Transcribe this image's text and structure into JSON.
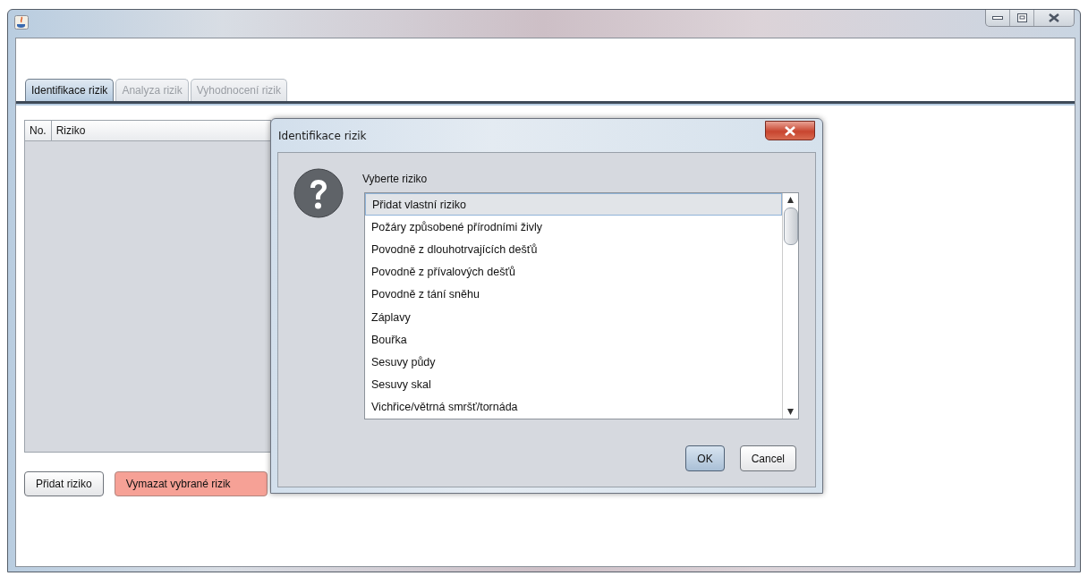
{
  "tabs": [
    {
      "label": "Identifikace rizik",
      "selected": true,
      "disabled": false
    },
    {
      "label": "Analyza rizik",
      "selected": false,
      "disabled": true
    },
    {
      "label": "Vyhodnocení rizik",
      "selected": false,
      "disabled": true
    }
  ],
  "table": {
    "columns": [
      "No.",
      "Riziko"
    ]
  },
  "buttons": [
    {
      "label": "Přidat riziko",
      "kind": "normal"
    },
    {
      "label": "Vymazat vybrané rizik",
      "kind": "danger"
    }
  ],
  "dialog": {
    "title": "Identifikace rizik",
    "prompt": "Vyberte riziko",
    "options": [
      {
        "label": "Přidat vlastní riziko",
        "selected": true
      },
      {
        "label": "Požáry způsobené přírodními živly",
        "selected": false
      },
      {
        "label": "Povodně z dlouhotrvajících dešťů",
        "selected": false
      },
      {
        "label": "Povodně z přívalových dešťů",
        "selected": false
      },
      {
        "label": "Povodně z tání sněhu",
        "selected": false
      },
      {
        "label": "Záplavy",
        "selected": false
      },
      {
        "label": "Bouřka",
        "selected": false
      },
      {
        "label": "Sesuvy půdy",
        "selected": false
      },
      {
        "label": "Sesuvy skal",
        "selected": false
      },
      {
        "label": "Vichřice/větrná smršť/tornáda",
        "selected": false
      }
    ],
    "buttons": [
      {
        "label": "OK",
        "kind": "default"
      },
      {
        "label": "Cancel",
        "kind": "normal"
      }
    ]
  }
}
